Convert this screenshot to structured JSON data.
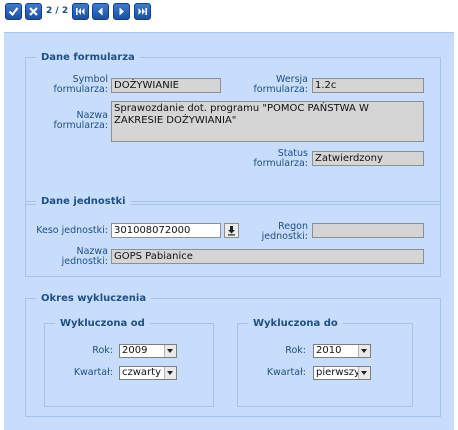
{
  "toolbar": {
    "pager": "2 / 2"
  },
  "form_data": {
    "legend": "Dane formularza",
    "symbol_label": "Symbol formularza:",
    "symbol_value": "DOŻYWIANIE",
    "version_label": "Wersja formularza:",
    "version_value": "1.2c",
    "name_label": "Nazwa formularza:",
    "name_value": "Sprawozdanie dot. programu \"POMOC PAŃSTWA W ZAKRESIE DOŻYWIANIA\"",
    "status_label": "Status formularza:",
    "status_value": "Zatwierdzony"
  },
  "unit_data": {
    "legend": "Dane jednostki",
    "keso_label": "Keso jednostki:",
    "keso_value": "301008072000",
    "regon_label": "Regon jednostki:",
    "regon_value": "",
    "name_label": "Nazwa jednostki:",
    "name_value": "GOPS Pabianice"
  },
  "exclusion": {
    "legend": "Okres wykluczenia",
    "from": {
      "legend": "Wykluczona od",
      "year_label": "Rok:",
      "year_value": "2009",
      "quarter_label": "Kwartał:",
      "quarter_value": "czwarty"
    },
    "to": {
      "legend": "Wykluczona do",
      "year_label": "Rok:",
      "year_value": "2010",
      "quarter_label": "Kwartał:",
      "quarter_value": "pierwszy"
    }
  },
  "colors": {
    "panel": "#c7ddfb",
    "border": "#a6c3ea",
    "label": "#1f4f86",
    "field": "#d5d5d5",
    "button": "#2a63b8"
  }
}
